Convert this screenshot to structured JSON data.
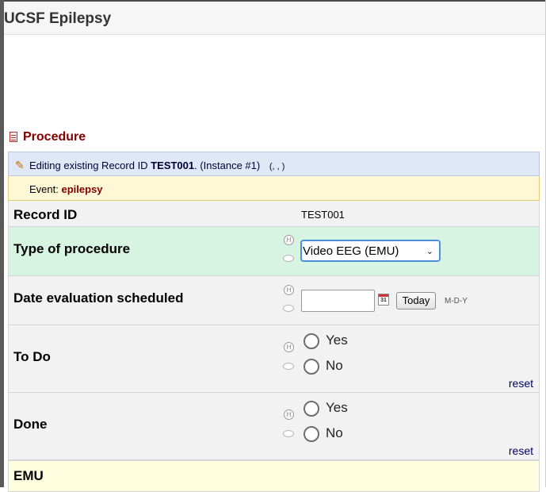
{
  "app": {
    "title": "UCSF Epilepsy"
  },
  "form": {
    "title": "Procedure"
  },
  "edit_bar": {
    "prefix": "Editing existing Record ID",
    "record_id": "TEST001",
    "suffix": ". (Instance #1)",
    "note": "(, , )"
  },
  "event": {
    "label": "Event:",
    "name": "epilepsy"
  },
  "fields": {
    "record_id": {
      "label": "Record ID",
      "value": "TEST001"
    },
    "type_of_procedure": {
      "label": "Type of procedure",
      "selected": "Video EEG (EMU)"
    },
    "date_evaluation_scheduled": {
      "label": "Date evaluation scheduled",
      "value": "",
      "today_label": "Today",
      "format": "M-D-Y",
      "calendar_day": "31"
    },
    "to_do": {
      "label": "To Do",
      "options": [
        "Yes",
        "No"
      ],
      "reset_label": "reset"
    },
    "done": {
      "label": "Done",
      "options": [
        "Yes",
        "No"
      ],
      "reset_label": "reset"
    }
  },
  "section": {
    "title": "EMU"
  },
  "icons": {
    "history": "H",
    "comment": "comment-icon",
    "calendar": "calendar-icon",
    "pencil": "pencil-icon"
  }
}
